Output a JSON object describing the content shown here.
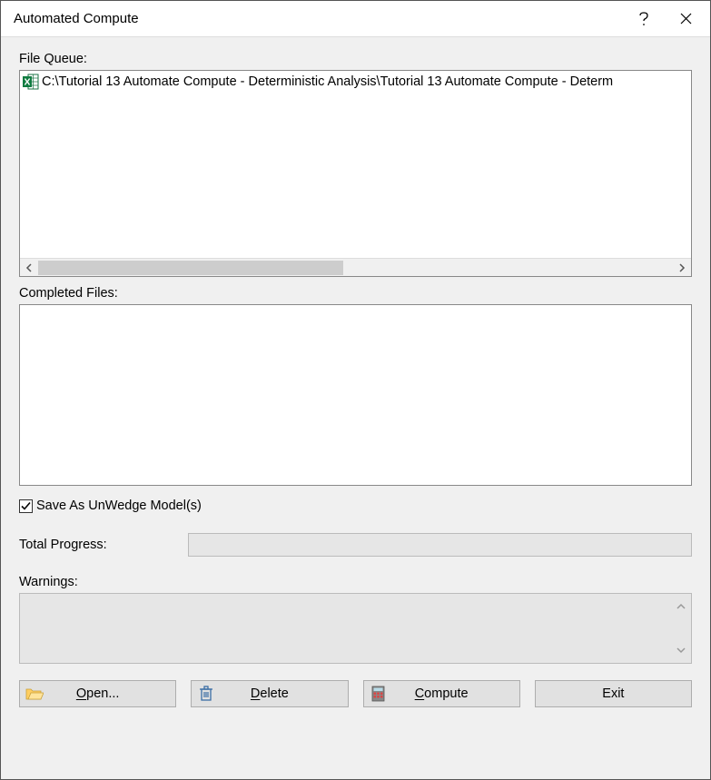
{
  "title": "Automated Compute",
  "labels": {
    "file_queue": "File Queue:",
    "completed_files": "Completed Files:",
    "total_progress": "Total Progress:",
    "warnings": "Warnings:"
  },
  "file_queue": {
    "items": [
      {
        "icon": "excel-icon",
        "path": "C:\\Tutorial 13 Automate Compute - Deterministic Analysis\\Tutorial 13 Automate Compute - Determ"
      }
    ]
  },
  "checkbox": {
    "save_as_unwedge": {
      "checked": true,
      "label": "Save As UnWedge Model(s)"
    }
  },
  "buttons": {
    "open": "Open...",
    "delete": "Delete",
    "compute": "Compute",
    "exit": "Exit"
  },
  "accelerators": {
    "open": "O",
    "delete": "D",
    "compute": "C"
  }
}
